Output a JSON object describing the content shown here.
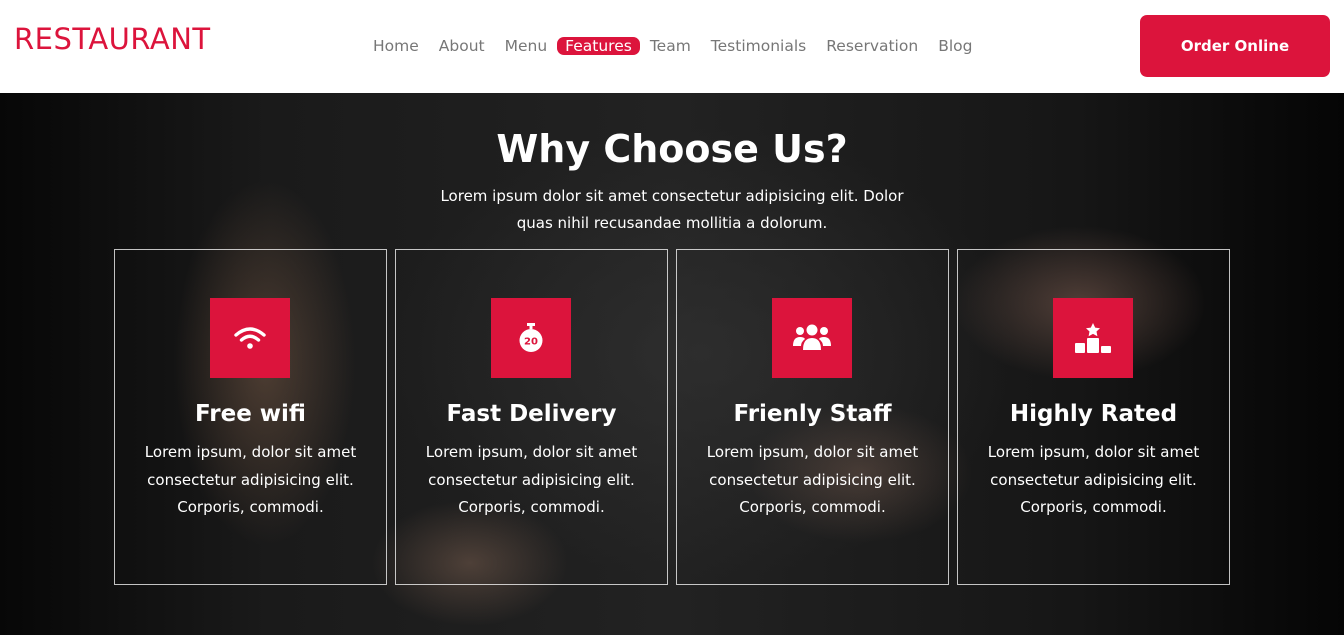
{
  "brand": {
    "name": "RESTAURANT",
    "color": "#dc143c"
  },
  "nav": {
    "items": [
      {
        "label": "Home",
        "active": false
      },
      {
        "label": "About",
        "active": false
      },
      {
        "label": "Menu",
        "active": false
      },
      {
        "label": "Features",
        "active": true
      },
      {
        "label": "Team",
        "active": false
      },
      {
        "label": "Testimonials",
        "active": false
      },
      {
        "label": "Reservation",
        "active": false
      },
      {
        "label": "Blog",
        "active": false
      }
    ],
    "order_button": "Order Online"
  },
  "hero": {
    "title": "Why Choose Us?",
    "subtitle": "Lorem ipsum dolor sit amet consectetur adipisicing elit. Dolor quas nihil recusandae mollitia a dolorum."
  },
  "features": [
    {
      "icon": "wifi-icon",
      "title": "Free wifi",
      "text": "Lorem ipsum, dolor sit amet consectetur adipisicing elit. Corporis, commodi."
    },
    {
      "icon": "stopwatch-icon",
      "title": "Fast Delivery",
      "text": "Lorem ipsum, dolor sit amet consectetur adipisicing elit. Corporis, commodi."
    },
    {
      "icon": "users-icon",
      "title": "Frienly Staff",
      "text": "Lorem ipsum, dolor sit amet consectetur adipisicing elit. Corporis, commodi."
    },
    {
      "icon": "ranking-star-icon",
      "title": "Highly Rated",
      "text": "Lorem ipsum, dolor sit amet consectetur adipisicing elit. Corporis, commodi."
    }
  ],
  "stopwatch_number": "20",
  "colors": {
    "accent": "#dc143c",
    "nav_text": "#777777",
    "card_border": "#ffffff"
  }
}
